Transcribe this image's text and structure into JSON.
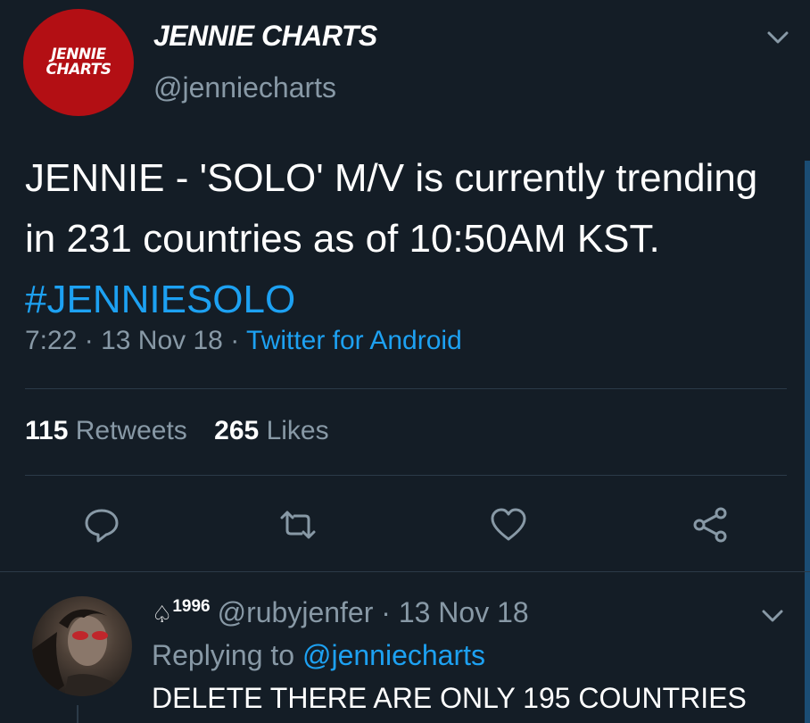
{
  "tweet": {
    "avatar_text_line1": "JENNIE",
    "avatar_text_line2": "CHARTS",
    "display_name": "JENNIE CHARTS",
    "handle": "@jenniecharts",
    "text_main": "JENNIE - 'SOLO' M/V is currently trending in 231 countries as of 10:50AM KST.",
    "hashtag": "#JENNIESOLO",
    "time": "7:22",
    "date": "13 Nov 18",
    "via": "Twitter for Android",
    "retweets_count": "115",
    "retweets_label": "Retweets",
    "likes_count": "265",
    "likes_label": "Likes"
  },
  "reply": {
    "badge": "1996",
    "handle": "@rubyjenfer",
    "date": "13 Nov 18",
    "replying_prefix": "Replying to",
    "replying_to": "@jenniecharts",
    "text": "DELETE THERE ARE ONLY 195 COUNTRIES"
  },
  "icons": {
    "reply": "reply-icon",
    "retweet": "retweet-icon",
    "like": "heart-icon",
    "share": "share-icon",
    "menu": "chevron-down-icon"
  }
}
